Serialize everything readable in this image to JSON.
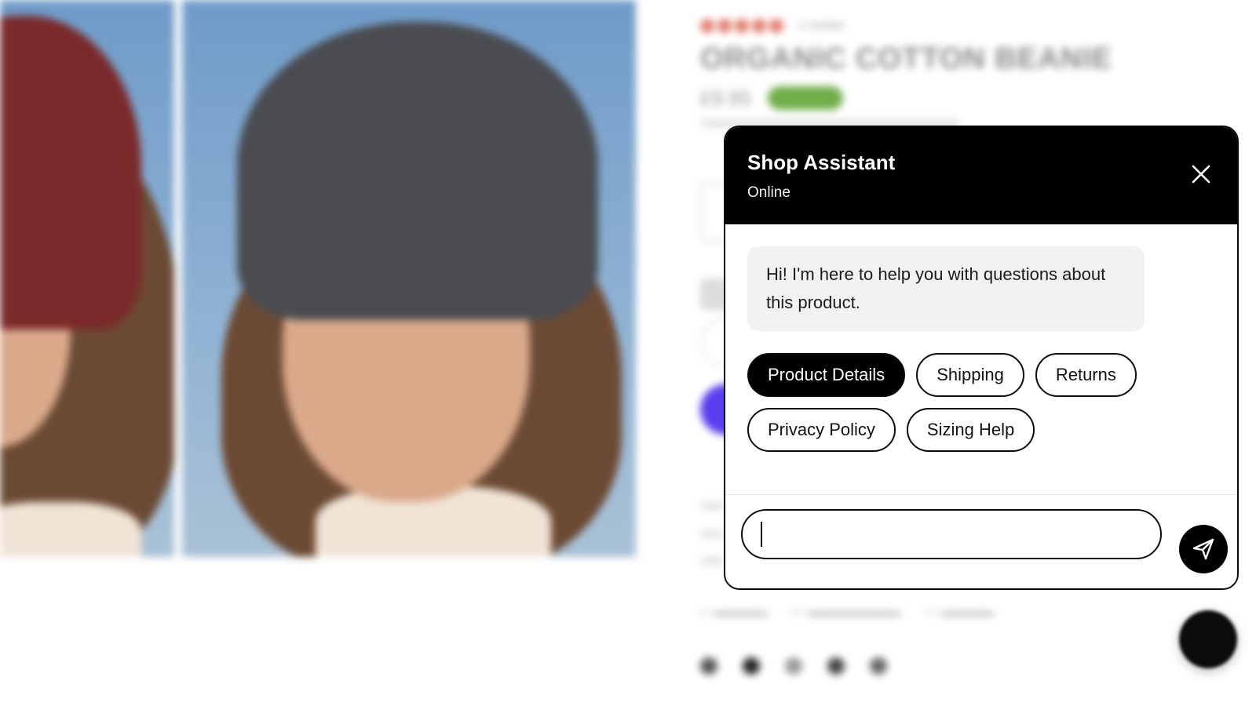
{
  "product": {
    "rating_text": "1 review",
    "title": "ORGANIC COTTON BEANIE",
    "price": "£9.95"
  },
  "chat": {
    "title": "Shop Assistant",
    "status": "Online",
    "greeting": "Hi! I'm here to help you with questions about this product.",
    "quick_replies": [
      {
        "label": "Product Details"
      },
      {
        "label": "Shipping"
      },
      {
        "label": "Returns"
      },
      {
        "label": "Privacy Policy"
      },
      {
        "label": "Sizing Help"
      }
    ],
    "active_reply": "Product Details",
    "input": {
      "value": "",
      "placeholder": ""
    },
    "icons": {
      "close": "close-icon",
      "send": "send-icon"
    }
  },
  "colors": {
    "chat_header_bg": "#000000",
    "chip_active_bg": "#000000",
    "bubble_bg": "#f1f2f4"
  }
}
